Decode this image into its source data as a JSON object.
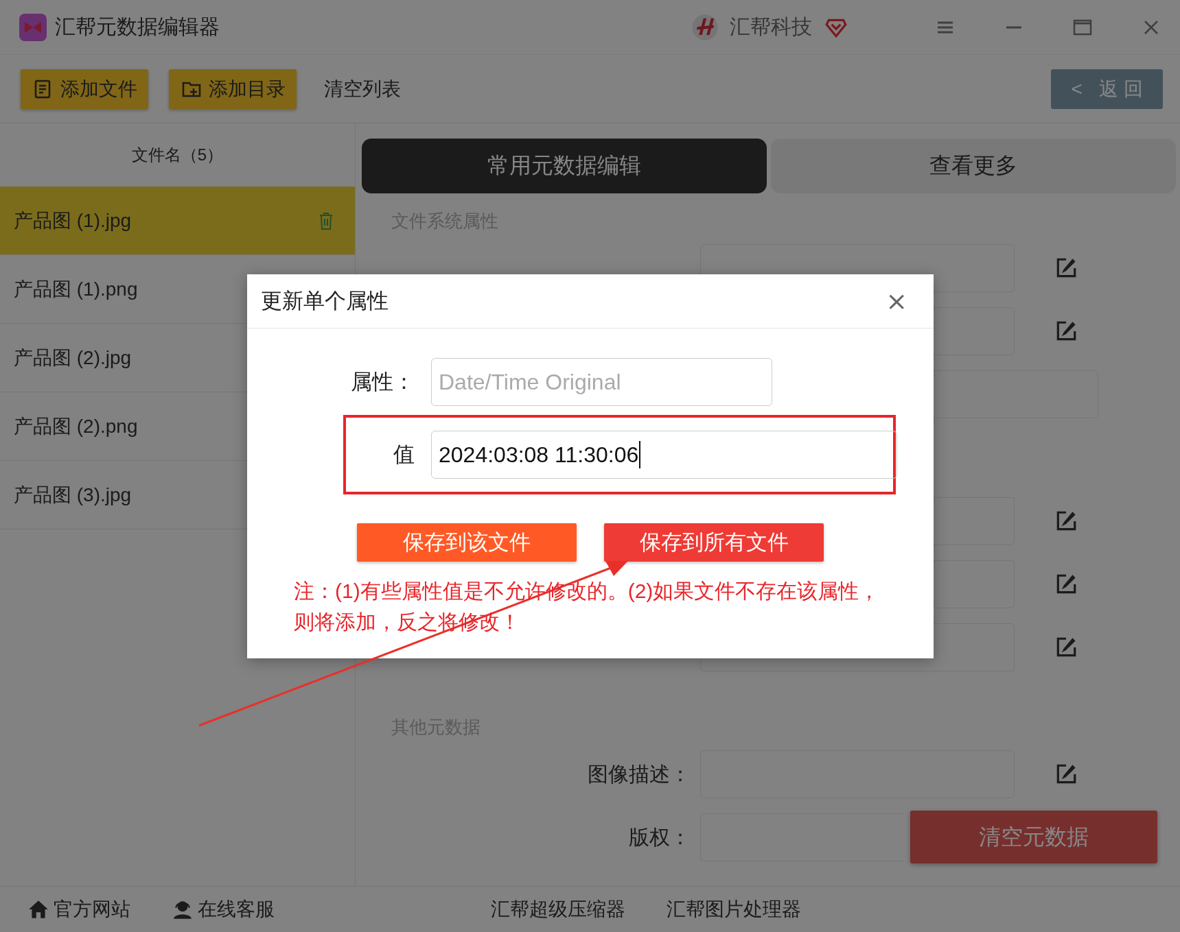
{
  "window": {
    "title": "汇帮元数据编辑器",
    "brand": "汇帮科技"
  },
  "toolbar": {
    "buttons": [
      {
        "label": "添加文件",
        "kind": "file"
      },
      {
        "label": "添加目录",
        "kind": "folder"
      },
      {
        "label": "清空列表",
        "kind": "plain"
      }
    ],
    "back": {
      "arrow": "<",
      "label": "返 回"
    }
  },
  "file_list": {
    "header": "文件名（5）",
    "items": [
      {
        "name": "产品图 (1).jpg",
        "selected": true
      },
      {
        "name": "产品图 (1).png",
        "selected": false
      },
      {
        "name": "产品图 (2).jpg",
        "selected": false
      },
      {
        "name": "产品图 (2).png",
        "selected": false
      },
      {
        "name": "产品图 (3).jpg",
        "selected": false
      }
    ]
  },
  "tabs": [
    {
      "label": "常用元数据编辑",
      "selected": true
    },
    {
      "label": "查看更多",
      "selected": false
    }
  ],
  "sections": [
    {
      "title": "文件系统属性",
      "rows": [
        {
          "kind": "field"
        },
        {
          "kind": "field"
        },
        {
          "kind": "wide"
        }
      ]
    },
    {
      "rows": [
        {
          "kind": "field"
        },
        {
          "kind": "field"
        },
        {
          "kind": "field"
        }
      ]
    },
    {
      "title": "其他元数据",
      "rows": [
        {
          "kind": "field",
          "label": "图像描述："
        },
        {
          "kind": "partial",
          "label": "版权："
        }
      ]
    }
  ],
  "clear_button": "清空元数据",
  "status_bar": {
    "links": [
      {
        "label": "官方网站",
        "kind": "home"
      },
      {
        "label": "在线客服",
        "kind": "support"
      },
      {
        "label": "汇帮超级压缩器",
        "kind": "plain"
      },
      {
        "label": "汇帮图片处理器",
        "kind": "plain"
      }
    ]
  },
  "dialog": {
    "title": "更新单个属性",
    "close": "×",
    "property": {
      "label": "属性：",
      "value": "Date/Time Original",
      "disabled": true
    },
    "value": {
      "label": "值",
      "value": "2024:03:08 11:30:06",
      "focused": true,
      "highlighted": true
    },
    "buttons": [
      {
        "label": "保存到该文件",
        "kind": "primary"
      },
      {
        "label": "保存到所有文件",
        "kind": "danger"
      }
    ],
    "note": "注：(1)有些属性值是不允许修改的。(2)如果文件不存在该属性，则将添加，反之将修改！"
  }
}
